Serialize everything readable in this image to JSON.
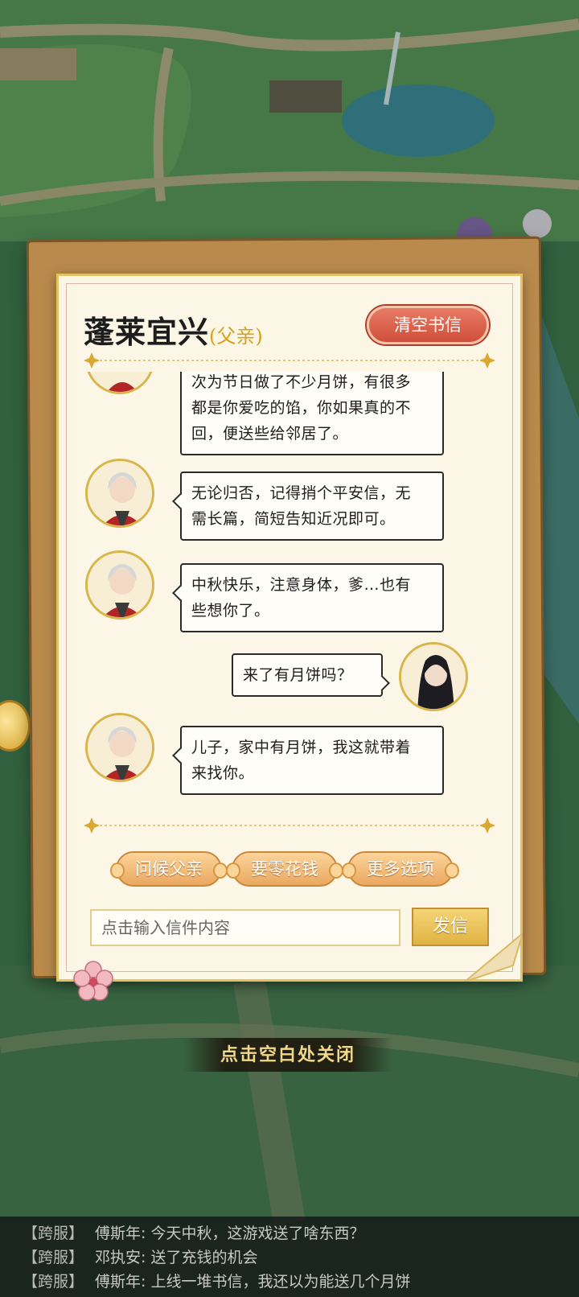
{
  "letter": {
    "title": "蓬莱宜兴",
    "relation": "(父亲)",
    "clear_button": "清空书信"
  },
  "messages": [
    {
      "sender": "father",
      "text": "次为节日做了不少月饼，有很多都是你爱吃的馅，你如果真的不回，便送些给邻居了。",
      "lines": [
        "次为节日做了不少月饼，有很多",
        "都是你爱吃的馅，你如果真的不",
        "回，便送些给邻居了。"
      ]
    },
    {
      "sender": "father",
      "text": "无论归否，记得捎个平安信，无需长篇，简短告知近况即可。",
      "lines": [
        "无论归否，记得捎个平安信，无",
        "需长篇，简短告知近况即可。"
      ]
    },
    {
      "sender": "father",
      "text": "中秋快乐，注意身体，爹…也有些想你了。",
      "lines": [
        "中秋快乐，注意身体，爹…也有",
        "些想你了。"
      ]
    },
    {
      "sender": "player",
      "text": "来了有月饼吗？",
      "lines": [
        "来了有月饼吗？"
      ]
    },
    {
      "sender": "father",
      "text": "儿子，家中有月饼，我这就带着来找你。",
      "lines": [
        "儿子，家中有月饼，我这就带着",
        "来找你。"
      ]
    }
  ],
  "options": [
    "问候父亲",
    "要零花钱",
    "更多选项"
  ],
  "input": {
    "placeholder": "点击输入信件内容",
    "value": ""
  },
  "send_button": "发信",
  "close_hint": "点击空白处关闭",
  "chat": [
    {
      "tag": "【跨服】",
      "name": "傅斯年",
      "text": ": 今天中秋，这游戏送了啥东西？"
    },
    {
      "tag": "【跨服】",
      "name": "邓执安",
      "text": ": 送了充钱的机会"
    },
    {
      "tag": "【跨服】",
      "name": "傅斯年",
      "text": ": 上线一堆书信，我还以为能送几个月饼"
    }
  ],
  "colors": {
    "accent_red": "#cf4f3b",
    "accent_gold": "#e0b243",
    "paper": "#fcf6e6"
  }
}
